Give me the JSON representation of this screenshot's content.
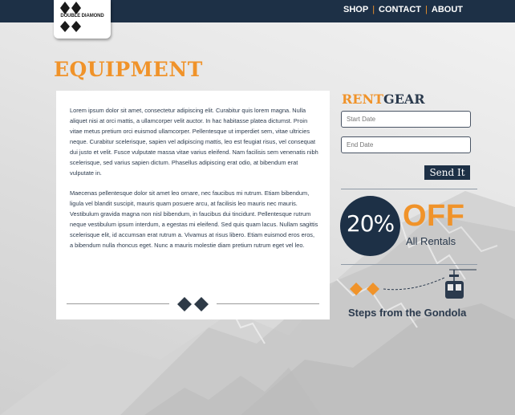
{
  "brand": {
    "logo_text": "DOUBLE DIAMOND"
  },
  "nav": {
    "items": [
      "SHOP",
      "CONTACT",
      "ABOUT"
    ],
    "separator": "|"
  },
  "page": {
    "title": "EQUIPMENT"
  },
  "content": {
    "paragraph1": " Lorem ipsum dolor sit amet, consectetur adipiscing elit. Curabitur quis lorem magna. Nulla aliquet nisi at orci mattis, a ullamcorper velit auctor. In hac habitasse platea dictumst. Proin vitae metus pretium orci euismod ullamcorper. Pellentesque ut imperdiet sem, vitae ultricies neque. Curabitur scelerisque, sapien vel adipiscing mattis, leo est feugiat risus, vel consequat dui justo et velit. Fusce vulputate massa vitae varius eleifend. Nam facilisis sem venenatis nibh scelerisque, sed varius sapien dictum. Phasellus adipiscing erat odio, at bibendum erat vulputate in.",
    "paragraph2": "Maecenas pellentesque dolor sit amet leo ornare, nec faucibus mi rutrum. Etiam bibendum, ligula vel blandit suscipit, mauris quam posuere arcu, at facilisis leo mauris nec mauris. Vestibulum gravida magna non nisl bibendum, in faucibus dui tincidunt. Pellentesque rutrum neque vestibulum ipsum interdum, a egestas mi eleifend. Sed quis quam lacus. Nullam sagittis scelerisque elit, id accumsan erat rutrum a. Vivamus at risus libero. Etiam euismod eros eros, a bibendum nulla rhoncus eget. Nunc a mauris molestie diam pretium rutrum eget vel leo."
  },
  "rent_form": {
    "title_part1": "RENT",
    "title_part2": "GEAR",
    "start_placeholder": "Start Date",
    "end_placeholder": "End Date",
    "submit_label": "Send It"
  },
  "promo": {
    "percent": "20%",
    "off": "OFF",
    "subtitle": "All Rentals"
  },
  "gondola": {
    "text": "Steps from the Gondola"
  },
  "colors": {
    "navy": "#1d3046",
    "orange": "#f0932a",
    "text": "#2b3a4d"
  }
}
